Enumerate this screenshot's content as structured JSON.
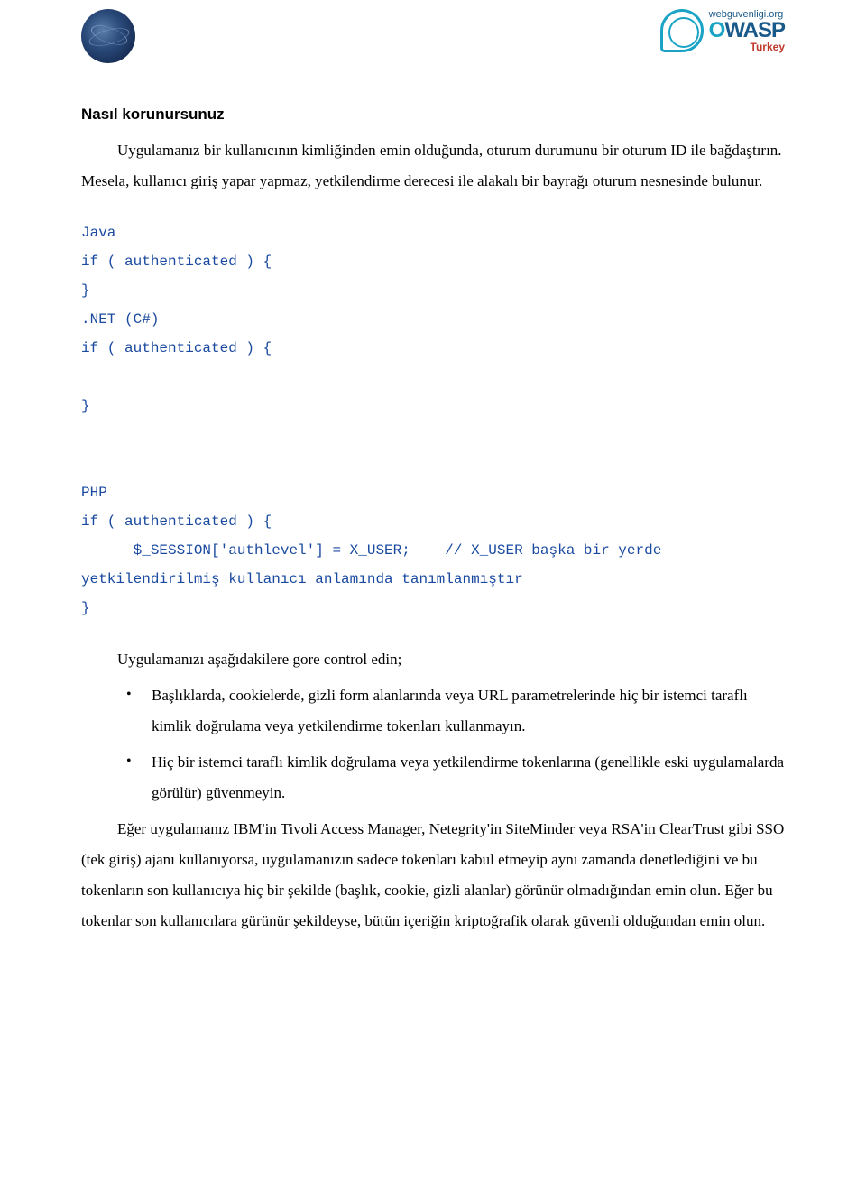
{
  "logos": {
    "left_name": "globe-logo",
    "right": {
      "url": "webguvenligi.org",
      "name_html": "OWASP",
      "sub": "Turkey"
    }
  },
  "heading": "Nasıl korunursunuz",
  "intro": "Uygulamanız bir kullanıcının kimliğinden emin olduğunda, oturum durumunu bir oturum ID ile bağdaştırın. Mesela, kullanıcı giriş yapar yapmaz, yetkilendirme derecesi ile alakalı bir bayrağı oturum nesnesinde bulunur.",
  "code": "Java\nif ( authenticated ) {\n}\n.NET (C#)\nif ( authenticated ) {\n\n}\n\n\nPHP\nif ( authenticated ) {\n      $_SESSION['authlevel'] = X_USER;    // X_USER başka bir yerde\nyetkilendirilmiş kullanıcı anlamında tanımlanmıştır\n}",
  "check_intro": "Uygulamanızı aşağıdakilere gore control edin;",
  "bullets": [
    "Başlıklarda, cookielerde, gizli form alanlarında veya URL parametrelerinde hiç bir istemci taraflı kimlik doğrulama veya yetkilendirme tokenları kullanmayın.",
    "Hiç bir istemci taraflı kimlik doğrulama veya yetkilendirme tokenlarına (genellikle eski uygulamalarda görülür) güvenmeyin."
  ],
  "closing": "Eğer uygulamanız IBM'in Tivoli Access Manager, Netegrity'in SiteMinder veya RSA'in ClearTrust gibi SSO (tek giriş) ajanı kullanıyorsa, uygulamanızın sadece tokenları kabul etmeyip aynı zamanda denetlediğini ve bu tokenların son kullanıcıya hiç bir şekilde (başlık, cookie, gizli alanlar) görünür olmadığından emin olun. Eğer bu tokenlar son kullanıcılara gürünür şekildeyse, bütün içeriğin kriptoğrafik olarak güvenli olduğundan emin olun."
}
